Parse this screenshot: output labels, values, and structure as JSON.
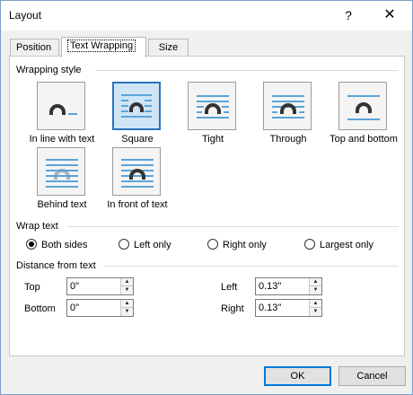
{
  "window": {
    "title": "Layout",
    "help_label": "?",
    "close_label": "✕"
  },
  "tabs": [
    {
      "label": "Position",
      "active": false
    },
    {
      "label": "Text Wrapping",
      "active": true
    },
    {
      "label": "Size",
      "active": false
    }
  ],
  "wrapping_style": {
    "heading": "Wrapping style",
    "options": [
      {
        "label": "In line with text",
        "icon": "inline-with-text-icon",
        "selected": false
      },
      {
        "label": "Square",
        "icon": "square-wrap-icon",
        "selected": true
      },
      {
        "label": "Tight",
        "icon": "tight-wrap-icon",
        "selected": false
      },
      {
        "label": "Through",
        "icon": "through-wrap-icon",
        "selected": false
      },
      {
        "label": "Top and bottom",
        "icon": "top-and-bottom-wrap-icon",
        "selected": false
      },
      {
        "label": "Behind text",
        "icon": "behind-text-icon",
        "selected": false
      },
      {
        "label": "In front of text",
        "icon": "in-front-of-text-icon",
        "selected": false
      }
    ]
  },
  "wrap_text": {
    "heading": "Wrap text",
    "options": [
      {
        "label": "Both sides",
        "checked": true
      },
      {
        "label": "Left only",
        "checked": false
      },
      {
        "label": "Right only",
        "checked": false
      },
      {
        "label": "Largest only",
        "checked": false
      }
    ]
  },
  "distance": {
    "heading": "Distance from text",
    "top": {
      "label": "Top",
      "value": "0\""
    },
    "bottom": {
      "label": "Bottom",
      "value": "0\""
    },
    "left": {
      "label": "Left",
      "value": "0.13\""
    },
    "right": {
      "label": "Right",
      "value": "0.13\""
    }
  },
  "buttons": {
    "ok": "OK",
    "cancel": "Cancel"
  },
  "colors": {
    "accent": "#2a73bd",
    "text_line": "#5ba4d6",
    "shape": "#333333",
    "shape_behind": "#a8b4bf"
  }
}
